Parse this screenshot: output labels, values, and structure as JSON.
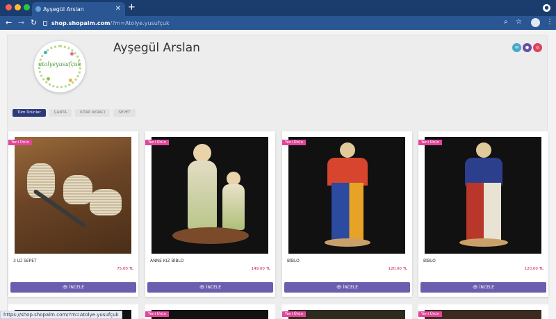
{
  "browser": {
    "tab_title": "Ayşegül Arslan",
    "tab_close": "✕",
    "new_tab": "+",
    "url_host": "shop.shopalm.com",
    "url_path": "/?m=Atolye.yusufçuk",
    "status_url": "https://shop.shopalm.com/?m=Atolye.yusufçuk"
  },
  "shop": {
    "title": "Ayşegül Arslan",
    "logo_text": "atolyeyusufçuk"
  },
  "categories": [
    {
      "label": "Tüm Ürünler",
      "active": true
    },
    {
      "label": "ÇANTA",
      "active": false
    },
    {
      "label": "KİTAP AYRACI",
      "active": false
    },
    {
      "label": "SEPET",
      "active": false
    }
  ],
  "products": [
    {
      "badge": "Yeni Ürün",
      "name": "3 LÜ SEPET",
      "price": "75,00 TL",
      "button": "İNCELE"
    },
    {
      "badge": "Yeni Ürün",
      "name": "ANNE KIZ BİBLO",
      "price": "149,00 TL",
      "button": "İNCELE"
    },
    {
      "badge": "Yeni Ürün",
      "name": "BİBLO",
      "price": "120,00 TL",
      "button": "İNCELE"
    },
    {
      "badge": "Yeni Ürün",
      "name": "BİBLO",
      "price": "120,00 TL",
      "button": "İNCELE"
    }
  ],
  "second_row_badges": [
    "Yeni Ürün",
    "Yeni Ürün",
    "Yeni Ürün"
  ],
  "colors": {
    "accent_button": "#6a5fae",
    "badge": "#e0479a",
    "price": "#c2185b",
    "active_category": "#2c3a7c"
  },
  "icons": {
    "eye": "eye-icon",
    "lock": "lock-icon",
    "search": "search-icon",
    "star": "star-icon"
  }
}
